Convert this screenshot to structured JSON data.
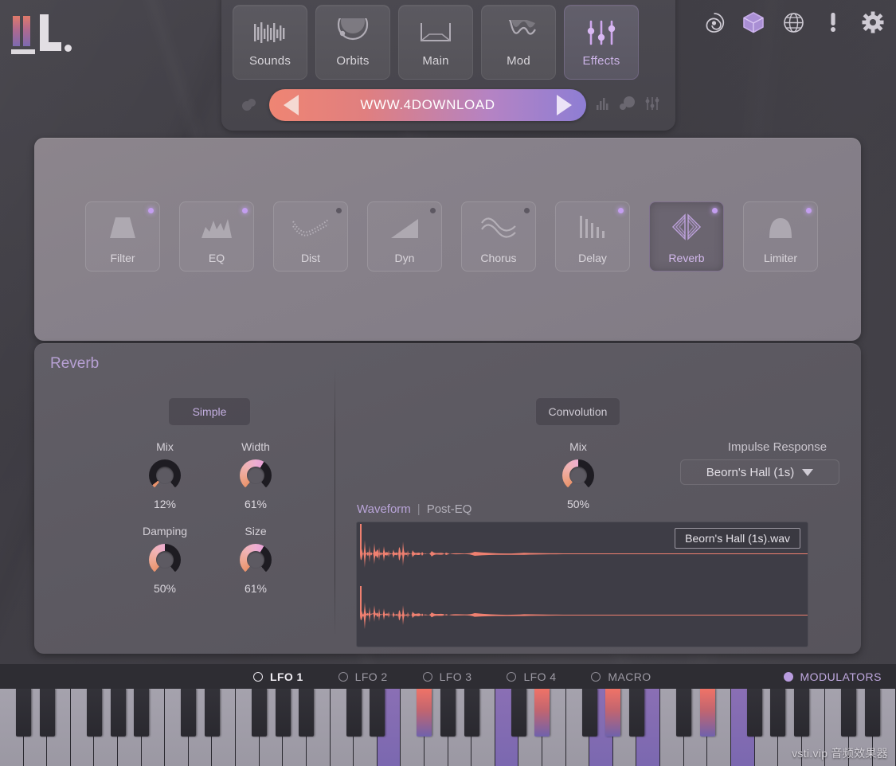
{
  "app": {
    "logo_name": "logo",
    "watermark": "vsti.vip 音频效果器"
  },
  "topnav": {
    "tabs": [
      {
        "label": "Sounds",
        "icon": "waveform-bars-icon",
        "active": false
      },
      {
        "label": "Orbits",
        "icon": "orbit-circle-icon",
        "active": false
      },
      {
        "label": "Main",
        "icon": "bracket-envelope-icon",
        "active": false
      },
      {
        "label": "Mod",
        "icon": "lfo-wave-icon",
        "active": false
      },
      {
        "label": "Effects",
        "icon": "sliders-icon",
        "active": true
      }
    ],
    "banner": {
      "text": "WWW.4DOWNLOAD",
      "prev_label": "previous-preset",
      "next_label": "next-preset"
    },
    "left_icon": "preset-browser-icon",
    "right_icons": [
      "spectrum-icon",
      "orbit-blob-icon",
      "mixer-sliders-icon"
    ]
  },
  "topright": {
    "icons": [
      "spiral-icon",
      "cube-icon",
      "globe-icon",
      "exclamation-icon",
      "gear-icon"
    ]
  },
  "rack": {
    "slots": [
      {
        "label": "Filter",
        "icon": "filter-trapezoid-icon",
        "led": true,
        "active": false
      },
      {
        "label": "EQ",
        "icon": "eq-curve-icon",
        "led": true,
        "active": false
      },
      {
        "label": "Dist",
        "icon": "distortion-icon",
        "led": false,
        "active": false
      },
      {
        "label": "Dyn",
        "icon": "dynamics-ramp-icon",
        "led": false,
        "active": false
      },
      {
        "label": "Chorus",
        "icon": "chorus-wave-icon",
        "led": false,
        "active": false
      },
      {
        "label": "Delay",
        "icon": "delay-taps-icon",
        "led": true,
        "active": false
      },
      {
        "label": "Reverb",
        "icon": "reverb-diamond-icon",
        "led": true,
        "active": true
      },
      {
        "label": "Limiter",
        "icon": "limiter-dome-icon",
        "led": true,
        "active": false
      }
    ]
  },
  "reverb": {
    "title": "Reverb",
    "simple": {
      "mode_label": "Simple",
      "knobs": [
        {
          "label": "Mix",
          "value": "12%",
          "pct": 12
        },
        {
          "label": "Width",
          "value": "61%",
          "pct": 61
        },
        {
          "label": "Damping",
          "value": "50%",
          "pct": 50
        },
        {
          "label": "Size",
          "value": "61%",
          "pct": 61
        }
      ]
    },
    "convolution": {
      "mode_label": "Convolution",
      "mix": {
        "label": "Mix",
        "value": "50%",
        "pct": 50
      },
      "ir_label": "Impulse Response",
      "ir_value": "Beorn's Hall (1s)",
      "waveform_tabs": [
        {
          "label": "Waveform",
          "active": true
        },
        {
          "label": "Post-EQ",
          "active": false
        }
      ],
      "waveform_sep": "|",
      "file_chip": "Beorn's Hall (1s).wav"
    }
  },
  "modbar": {
    "items": [
      {
        "label": "LFO 1",
        "active": true
      },
      {
        "label": "LFO 2",
        "active": false
      },
      {
        "label": "LFO 3",
        "active": false
      },
      {
        "label": "LFO 4",
        "active": false
      },
      {
        "label": "MACRO",
        "active": false
      }
    ],
    "modulators_label": "MODULATORS"
  },
  "colors": {
    "accent_purple": "#b99cdf",
    "accent_orange": "#ef8573",
    "panel_light": "#8a848c",
    "panel_dark": "#5c5961",
    "waveform": "#ef8070"
  },
  "keyboard": {
    "lit_white_keys": [
      16,
      21,
      25,
      27,
      31
    ],
    "lit_black_keys": [
      12,
      16,
      18,
      21
    ]
  }
}
